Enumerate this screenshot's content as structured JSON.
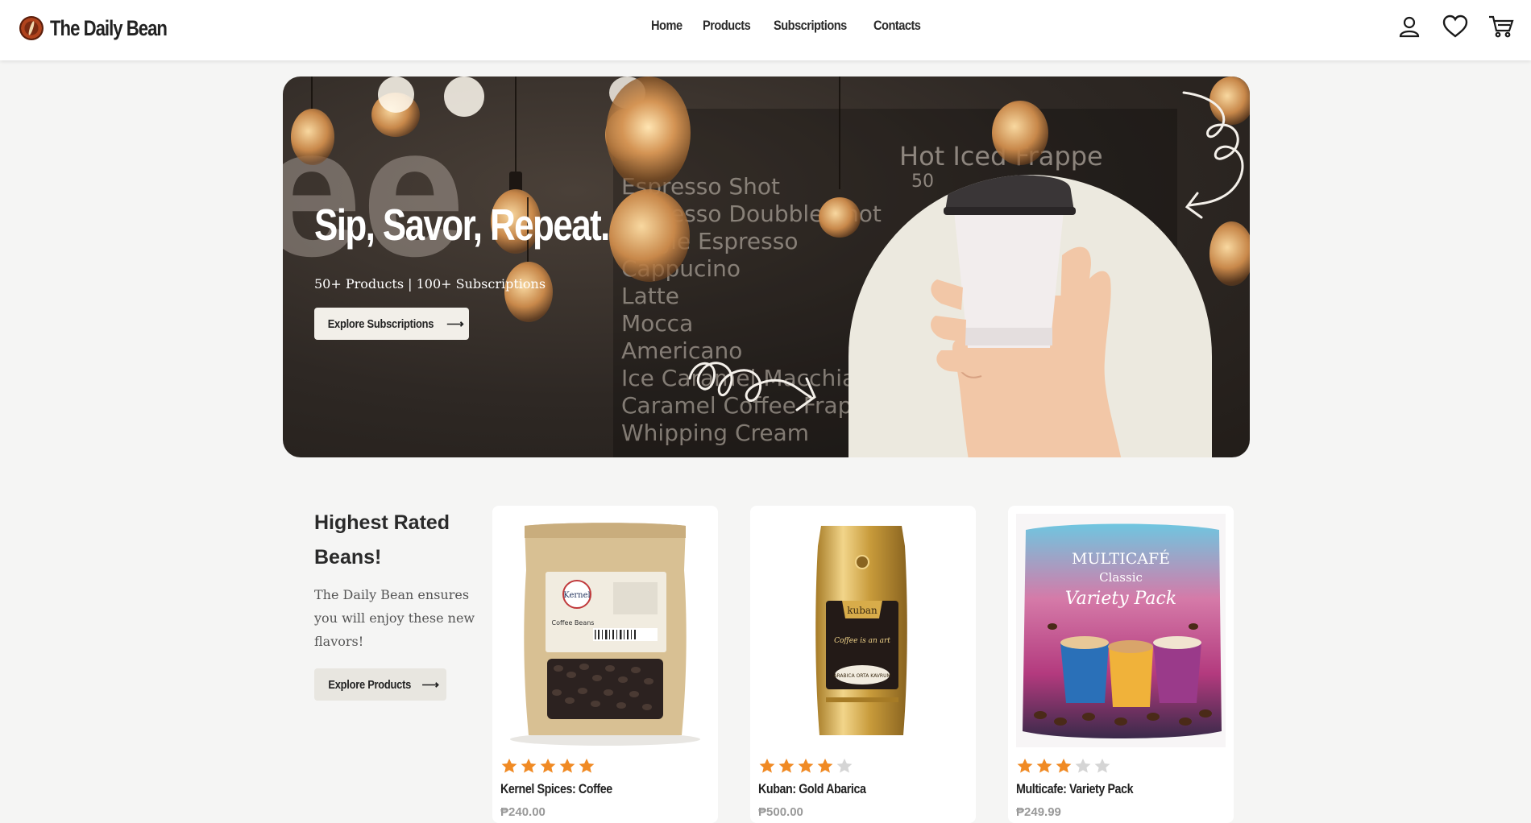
{
  "brand": {
    "name": "The Daily Bean"
  },
  "nav": {
    "links": [
      "Home",
      "Products",
      "Subscriptions",
      "Contacts"
    ],
    "icons": [
      "user-icon",
      "heart-icon",
      "cart-icon"
    ]
  },
  "hero": {
    "title": "Sip, Savor, Repeat.",
    "subtitle": "50+ Products | 100+ Subscriptions",
    "button_label": "Explore Subscriptions",
    "button_arrow": "⟶",
    "menu_heading": "Hot  Iced  Frappe",
    "menu_heading_sub": "50",
    "menu_items": [
      "Espresso Shot",
      "Espresso Doubble Shot",
      "Single Espresso",
      "Cappucino",
      "Latte",
      "Mocca",
      "Americano",
      "Ice Caramel Macchiato",
      "Caramel Coffee Frappe with",
      "Whipping Cream"
    ]
  },
  "section": {
    "title": "Highest Rated Beans!",
    "description": "The Daily Bean ensures you will enjoy these new flavors!",
    "button_label": "Explore Products",
    "button_arrow": "⟶"
  },
  "products": [
    {
      "name": "Kernel Spices: Coffee",
      "price": "₱240.00",
      "rating": 5,
      "label_text": "Kernel",
      "label_sub": "Coffee Beans"
    },
    {
      "name": "Kuban: Gold Abarica",
      "price": "₱500.00",
      "rating": 4,
      "label_text": "kuban",
      "label_sub": "Coffee is an art",
      "label_sub2": "ARABICA ORTA KAVRUM"
    },
    {
      "name": "Multicafe: Variety Pack",
      "price": "₱249.99",
      "rating": 3,
      "label_text": "MULTICAFÉ",
      "label_sub": "Classic",
      "label_sub2": "Variety Pack"
    }
  ],
  "colors": {
    "star_on": "#f08a24",
    "star_off": "#d5d5d5",
    "hero_bg": "#2e2824",
    "cup_circle": "#ece9df"
  }
}
